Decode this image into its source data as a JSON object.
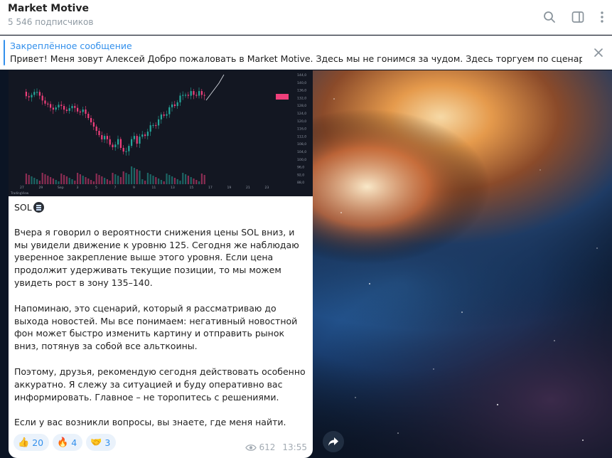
{
  "header": {
    "title": "Market Motive",
    "subscribers": "5 546 подписчиков"
  },
  "pinned": {
    "label": "Закреплённое сообщение",
    "text": "Привет! Меня зовут Алексей   Добро пожаловать в Market Motive.  Здесь мы не гонимся за чудом. Здесь торгуем по сценарию..."
  },
  "chart": {
    "price_tags": [
      "144,0",
      "140,0",
      "136,0",
      "132,0",
      "128,0",
      "124,0",
      "120,0",
      "116,0",
      "112,0",
      "108,0",
      "104,0",
      "100,0",
      "96,0",
      "92,0",
      "88,0"
    ],
    "time_ticks": [
      "27",
      "29",
      "Sep",
      "3",
      "5",
      "7",
      "9",
      "11",
      "13",
      "15",
      "17",
      "19",
      "21",
      "23"
    ],
    "logo": "TradingView",
    "colors": {
      "up": "#26a69a",
      "down": "#ef3f7b",
      "bg": "#131722"
    }
  },
  "message": {
    "title": "SOL",
    "paragraphs": [
      "Вчера я говорил о вероятности снижения цены SOL вниз, и мы увидели движение к уровню 125. Сегодня же наблюдаю уверенное закрепление выше этого уровня. Если цена продолжит удерживать текущие позиции, то мы можем увидеть рост в зону 135–140.",
      "Напоминаю, это сценарий, который я рассматриваю до выхода новостей. Мы все понимаем: негативный новостной фон может быстро изменить картину и отправить рынок вниз, потянув за собой все альткоины.",
      "Поэтому, друзья, рекомендую сегодня действовать особенно аккуратно. Я слежу за ситуацией и буду оперативно вас информировать. Главное – не торопитесь с решениями.",
      "Если у вас возникли вопросы, вы знаете, где меня найти."
    ],
    "reactions": [
      {
        "emoji": "👍",
        "count": "20"
      },
      {
        "emoji": "🔥",
        "count": "4"
      },
      {
        "emoji": "🤝",
        "count": "3"
      }
    ],
    "views": "612",
    "time": "13:55"
  },
  "icons": {
    "search": "search-icon",
    "sidebar": "sidebar-toggle-icon",
    "more": "more-vertical-icon",
    "close": "close-icon",
    "eye": "eye-icon",
    "forward": "forward-icon"
  },
  "colors": {
    "accent": "#3390ec",
    "bubble": "#ffffff",
    "reaction_bg": "#eaf2fb"
  }
}
